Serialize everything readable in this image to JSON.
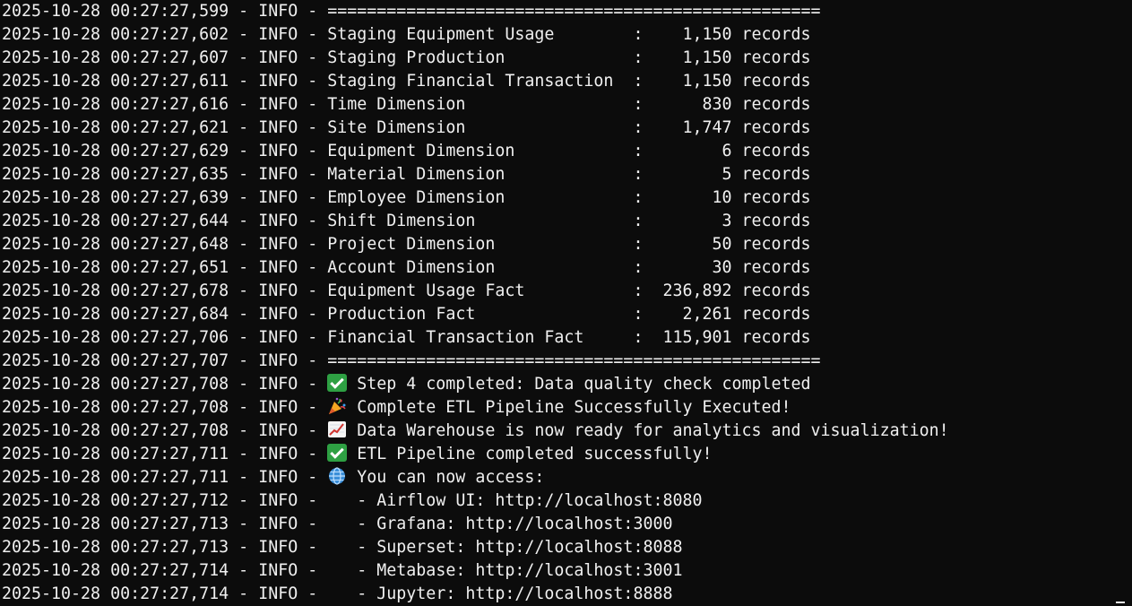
{
  "terminal": {
    "prefix_level": "INFO",
    "lines": [
      {
        "ts": "2025-10-28 00:27:27,599",
        "msg": "=================================================="
      },
      {
        "ts": "2025-10-28 00:27:27,602",
        "msg": "Staging Equipment Usage        :    1,150 records"
      },
      {
        "ts": "2025-10-28 00:27:27,607",
        "msg": "Staging Production             :    1,150 records"
      },
      {
        "ts": "2025-10-28 00:27:27,611",
        "msg": "Staging Financial Transaction  :    1,150 records"
      },
      {
        "ts": "2025-10-28 00:27:27,616",
        "msg": "Time Dimension                 :      830 records"
      },
      {
        "ts": "2025-10-28 00:27:27,621",
        "msg": "Site Dimension                 :    1,747 records"
      },
      {
        "ts": "2025-10-28 00:27:27,629",
        "msg": "Equipment Dimension            :        6 records"
      },
      {
        "ts": "2025-10-28 00:27:27,635",
        "msg": "Material Dimension             :        5 records"
      },
      {
        "ts": "2025-10-28 00:27:27,639",
        "msg": "Employee Dimension             :       10 records"
      },
      {
        "ts": "2025-10-28 00:27:27,644",
        "msg": "Shift Dimension                :        3 records"
      },
      {
        "ts": "2025-10-28 00:27:27,648",
        "msg": "Project Dimension              :       50 records"
      },
      {
        "ts": "2025-10-28 00:27:27,651",
        "msg": "Account Dimension              :       30 records"
      },
      {
        "ts": "2025-10-28 00:27:27,678",
        "msg": "Equipment Usage Fact           :  236,892 records"
      },
      {
        "ts": "2025-10-28 00:27:27,684",
        "msg": "Production Fact                :    2,261 records"
      },
      {
        "ts": "2025-10-28 00:27:27,706",
        "msg": "Financial Transaction Fact     :  115,901 records"
      },
      {
        "ts": "2025-10-28 00:27:27,707",
        "msg": "=================================================="
      },
      {
        "ts": "2025-10-28 00:27:27,708",
        "icon": "check-icon",
        "msg": "Step 4 completed: Data quality check completed"
      },
      {
        "ts": "2025-10-28 00:27:27,708",
        "icon": "party-popper-icon",
        "msg": "Complete ETL Pipeline Successfully Executed!"
      },
      {
        "ts": "2025-10-28 00:27:27,708",
        "icon": "chart-increasing-icon",
        "msg": "Data Warehouse is now ready for analytics and visualization!"
      },
      {
        "ts": "2025-10-28 00:27:27,711",
        "icon": "check-icon",
        "msg": "ETL Pipeline completed successfully!"
      },
      {
        "ts": "2025-10-28 00:27:27,711",
        "icon": "globe-icon",
        "msg": "You can now access:"
      },
      {
        "ts": "2025-10-28 00:27:27,712",
        "msg": "   - Airflow UI: http://localhost:8080"
      },
      {
        "ts": "2025-10-28 00:27:27,713",
        "msg": "   - Grafana: http://localhost:3000"
      },
      {
        "ts": "2025-10-28 00:27:27,713",
        "msg": "   - Superset: http://localhost:8088"
      },
      {
        "ts": "2025-10-28 00:27:27,714",
        "msg": "   - Metabase: http://localhost:3001"
      },
      {
        "ts": "2025-10-28 00:27:27,714",
        "msg": "   - Jupyter: http://localhost:8888"
      }
    ]
  },
  "colors": {
    "background": "#0c0c0c",
    "foreground": "#f0f0f0",
    "check": "#2ea043"
  }
}
